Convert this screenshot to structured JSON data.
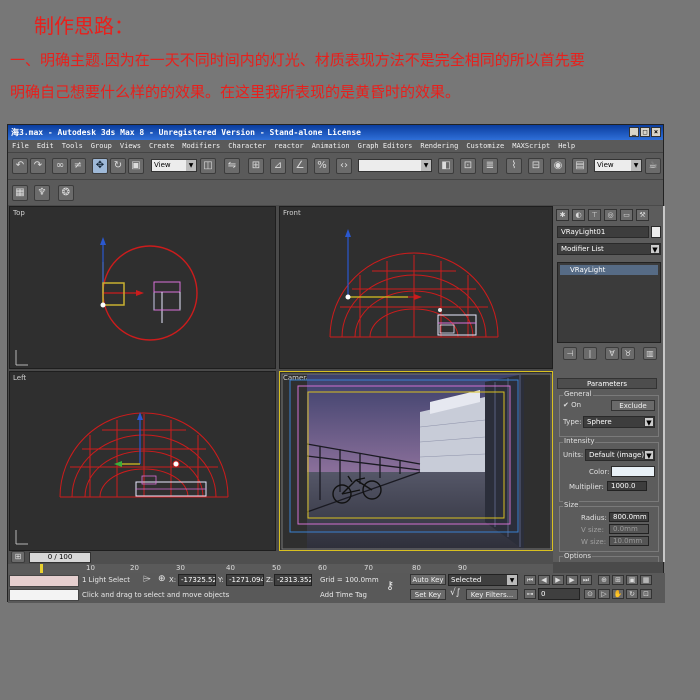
{
  "heading": "制作思路：",
  "description": {
    "line1": "一、明确主题.因为在一天不同时间内的灯光、材质表现方法不是完全相同的所以首先要",
    "line2": "明确自己想要什么样的的效果。在这里我所表现的是黄昏时的效果。"
  },
  "window": {
    "title": "海3.max - Autodesk 3ds Max 8  - Unregistered Version - Stand-alone License",
    "controls": [
      "_",
      "□",
      "×"
    ]
  },
  "menu": [
    "File",
    "Edit",
    "Tools",
    "Group",
    "Views",
    "Create",
    "Modifiers",
    "Character",
    "reactor",
    "Animation",
    "Graph Editors",
    "Rendering",
    "Customize",
    "MAXScript",
    "Help"
  ],
  "toolbar": {
    "refcoord": "View",
    "named_sel": "",
    "view_right": "View"
  },
  "viewports": {
    "top": "Top",
    "front": "Front",
    "left": "Left",
    "camera": "Camera"
  },
  "command_panel": {
    "object_name": "VRayLight01",
    "modifier_list": "Modifier List",
    "stack_item": "VRayLight",
    "parameters_label": "Parameters",
    "general_label": "General",
    "on_label": "On",
    "exclude_label": "Exclude",
    "type_label": "Type:",
    "type_value": "Sphere",
    "intensity_label": "Intensity",
    "units_label": "Units:",
    "units_value": "Default (image)",
    "color_label": "Color:",
    "multiplier_label": "Multiplier:",
    "multiplier_value": "1000.0",
    "size_label": "Size",
    "radius_label": "Radius:",
    "radius_value": "800.0mm",
    "vsize_label": "V size:",
    "vsize_value": "0.0mm",
    "wsize_label": "W size:",
    "wsize_value": "10.0mm",
    "options_label": "Options",
    "light_color": "#e8f0f6"
  },
  "timeline": {
    "frame_display": "0 / 100",
    "ticks": [
      "10",
      "20",
      "30",
      "40",
      "50",
      "60",
      "70",
      "80",
      "90"
    ]
  },
  "status": {
    "selection": "1 Light Select",
    "x_label": "X:",
    "x_value": "-17325.52r",
    "y_label": "Y:",
    "y_value": "-1271.094r",
    "z_label": "Z:",
    "z_value": "-2313.352r",
    "grid": "Grid = 100.0mm",
    "prompt": "Click and drag to select and move objects",
    "add_time_tag": "Add Time Tag",
    "auto_key": "Auto Key",
    "key_mode": "Selected",
    "set_key": "Set Key",
    "key_filters": "Key Filters...",
    "frame": "0"
  }
}
